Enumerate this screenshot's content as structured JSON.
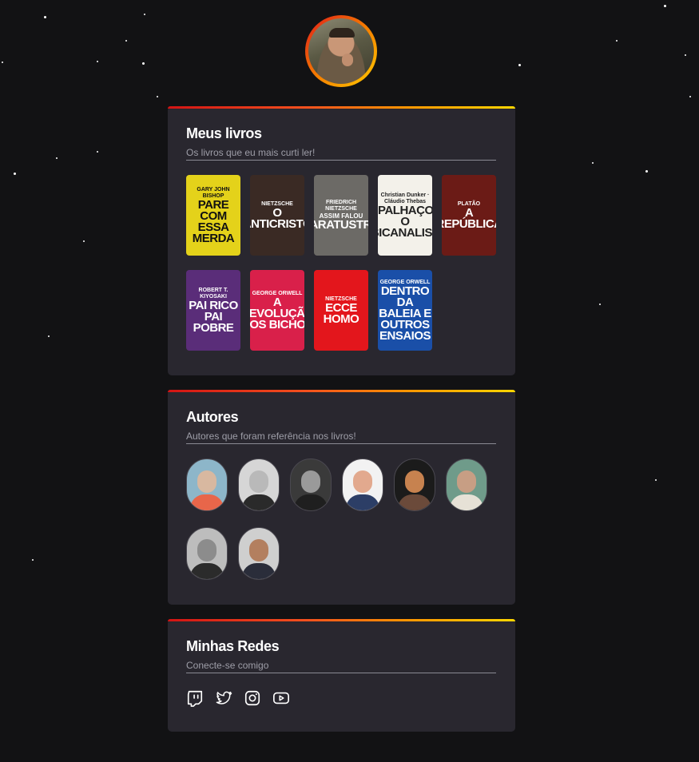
{
  "profile": {
    "avatar_alt": "profile-photo"
  },
  "books_section": {
    "title": "Meus livros",
    "subtitle": "Os livros que eu mais curti ler!",
    "books": [
      {
        "l1": "GARY JOHN BISHOP",
        "l2": "PARE COM ESSA MERDA",
        "l3": "",
        "bg": "#e4d21a",
        "fg": "#111111"
      },
      {
        "l1": "NIETZSCHE",
        "l2": "O ANTICRISTO",
        "l3": "",
        "bg": "#3a2a24",
        "fg": "#ffffff"
      },
      {
        "l1": "FRIEDRICH NIETZSCHE",
        "l2": "ZARATUSTRA",
        "l3": "ASSIM FALOU",
        "bg": "#6c6a66",
        "fg": "#ffffff"
      },
      {
        "l1": "Christian Dunker · Cláudio Thebas",
        "l2": "O PALHAÇO E O PSICANALISTA",
        "l3": "",
        "bg": "#f3f1ea",
        "fg": "#222222"
      },
      {
        "l1": "PLATÃO",
        "l2": "A REPÚBLICA",
        "l3": "",
        "bg": "#6b1b16",
        "fg": "#ffffff"
      },
      {
        "l1": "ROBERT T. KIYOSAKI",
        "l2": "PAI RICO PAI POBRE",
        "l3": "",
        "bg": "#5a2d79",
        "fg": "#ffffff"
      },
      {
        "l1": "GEORGE ORWELL",
        "l2": "A REVOLUÇÃO DOS BICHOS",
        "l3": "",
        "bg": "#d9204a",
        "fg": "#ffffff"
      },
      {
        "l1": "NIETZSCHE",
        "l2": "ECCE HOMO",
        "l3": "",
        "bg": "#e3161c",
        "fg": "#ffffff"
      },
      {
        "l1": "GEORGE ORWELL",
        "l2": "DENTRO DA BALEIA E OUTROS ENSAIOS",
        "l3": "",
        "bg": "#1a4fa8",
        "fg": "#ffffff"
      }
    ]
  },
  "authors_section": {
    "title": "Autores",
    "subtitle": "Autores que foram referência nos livros!",
    "authors": [
      {
        "name": "plato",
        "bg": "#8db6c9",
        "skin": "#d8b8a0",
        "cloth": "#e8664a"
      },
      {
        "name": "nietzsche",
        "bg": "#d6d6d6",
        "skin": "#b9b9b9",
        "cloth": "#2a2a2a"
      },
      {
        "name": "gary-john-bishop",
        "bg": "#3a3a3a",
        "skin": "#9a9a9a",
        "cloth": "#1f1f1f"
      },
      {
        "name": "christian-dunker",
        "bg": "#f2f2f2",
        "skin": "#e2a98e",
        "cloth": "#2c3e66"
      },
      {
        "name": "claudio-thebas",
        "bg": "#1b1b1b",
        "skin": "#c7824f",
        "cloth": "#6b4a3a"
      },
      {
        "name": "socrates",
        "bg": "#6f9b8a",
        "skin": "#c79e84",
        "cloth": "#e6e1d6"
      },
      {
        "name": "george-orwell",
        "bg": "#bdbdbd",
        "skin": "#8c8c8c",
        "cloth": "#2b2b2b"
      },
      {
        "name": "robert-kiyosaki",
        "bg": "#cfcfcf",
        "skin": "#b37f5f",
        "cloth": "#2a2d3a"
      }
    ]
  },
  "social_section": {
    "title": "Minhas Redes",
    "subtitle": "Conecte-se comigo",
    "links": [
      "twitch-icon",
      "twitter-icon",
      "instagram-icon",
      "youtube-icon"
    ]
  }
}
